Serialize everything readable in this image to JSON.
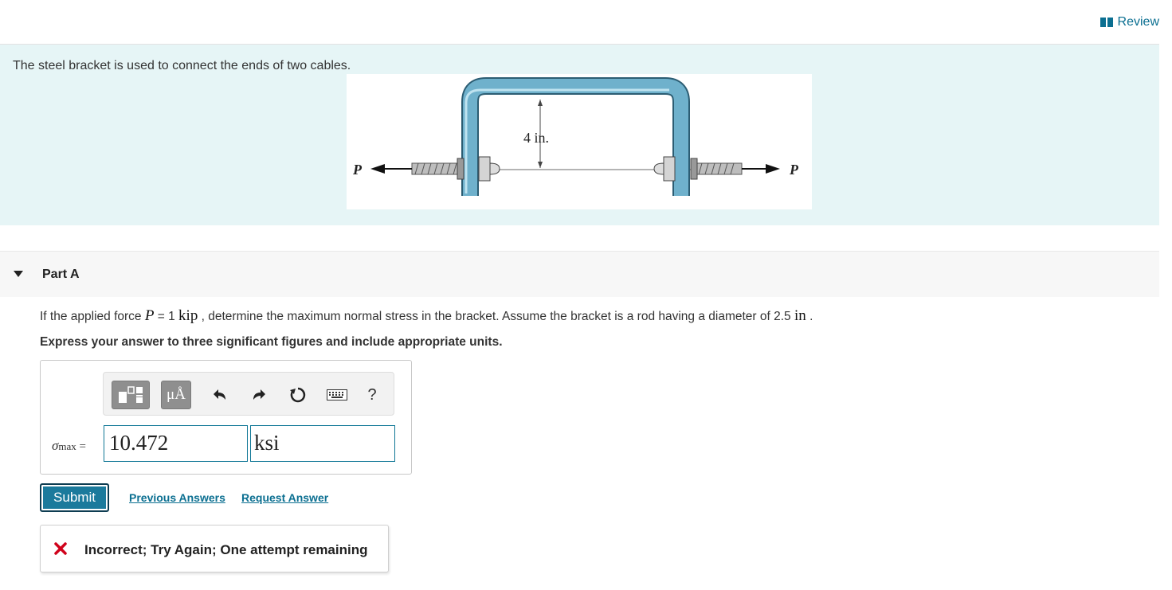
{
  "header": {
    "review_label": "Review",
    "review_icon": "book-icon"
  },
  "intro": {
    "text": "The steel bracket is used to connect the ends of two cables.",
    "figure": {
      "dimension_label": "4 in.",
      "force_left": "P",
      "force_right": "P"
    }
  },
  "part": {
    "title": "Part A",
    "question_pre": "If the applied force ",
    "q_var": "P",
    "q_eq": " = 1 ",
    "q_unit": "kip",
    "question_mid": " , determine the maximum normal stress in the bracket. Assume the bracket is a rod having a diameter of 2.5 ",
    "q_unit2": "in",
    "question_end": " .",
    "instruction": "Express your answer to three significant figures and include appropriate units."
  },
  "answer": {
    "toolbar": {
      "units_label": "μÅ",
      "help_label": "?"
    },
    "label_symbol": "σ",
    "label_sub": "max",
    "label_eq": " =",
    "value": "10.472",
    "unit": "ksi"
  },
  "actions": {
    "submit_label": "Submit",
    "previous_answers_label": "Previous Answers",
    "request_answer_label": "Request Answer"
  },
  "feedback": {
    "message": "Incorrect; Try Again; One attempt remaining"
  },
  "colors": {
    "accent": "#0b6f91",
    "intro_bg": "#e6f5f6",
    "bracket_blue": "#6fb1cc",
    "error_red": "#d0021b"
  }
}
